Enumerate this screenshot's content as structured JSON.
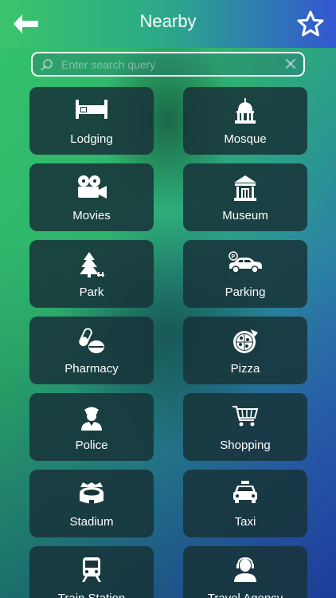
{
  "header": {
    "title": "Nearby"
  },
  "search": {
    "placeholder": "Enter search query"
  },
  "categories": [
    {
      "label": "Lodging",
      "icon": "bed-icon"
    },
    {
      "label": "Mosque",
      "icon": "mosque-icon"
    },
    {
      "label": "Movies",
      "icon": "film-projector-icon"
    },
    {
      "label": "Museum",
      "icon": "museum-icon"
    },
    {
      "label": "Park",
      "icon": "tree-icon"
    },
    {
      "label": "Parking",
      "icon": "parking-car-icon"
    },
    {
      "label": "Pharmacy",
      "icon": "pills-icon"
    },
    {
      "label": "Pizza",
      "icon": "pizza-icon"
    },
    {
      "label": "Police",
      "icon": "police-officer-icon"
    },
    {
      "label": "Shopping",
      "icon": "shopping-cart-icon"
    },
    {
      "label": "Stadium",
      "icon": "stadium-icon"
    },
    {
      "label": "Taxi",
      "icon": "taxi-icon"
    },
    {
      "label": "Train Station",
      "icon": "train-icon"
    },
    {
      "label": "Travel Agency",
      "icon": "agent-icon"
    }
  ],
  "colors": {
    "tile_bg": "#18343a",
    "accent_green": "#3bc46a",
    "accent_blue": "#3357d2"
  }
}
